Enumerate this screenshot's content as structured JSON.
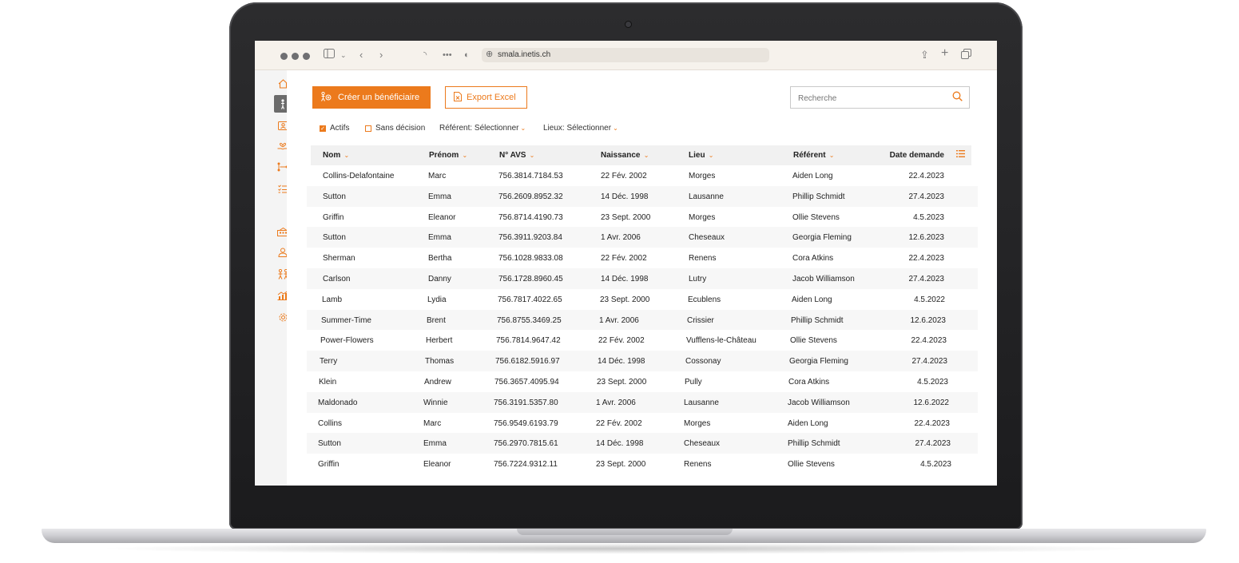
{
  "browser": {
    "url": "smala.inetis.ch"
  },
  "sidebar": {
    "items": [
      {
        "icon": "home-icon"
      },
      {
        "icon": "person-icon",
        "active": true
      },
      {
        "icon": "contact-card-icon"
      },
      {
        "icon": "hand-care-icon"
      },
      {
        "icon": "hierarchy-icon"
      },
      {
        "icon": "checklist-icon"
      },
      {
        "icon": "building-icon"
      },
      {
        "icon": "user-icon"
      },
      {
        "icon": "family-icon"
      },
      {
        "icon": "chart-icon"
      },
      {
        "icon": "gear-icon"
      }
    ]
  },
  "actions": {
    "create_label": "Créer un bénéficiaire",
    "export_label": "Export Excel",
    "search_placeholder": "Recherche"
  },
  "filters": {
    "actifs": {
      "label": "Actifs",
      "checked": true
    },
    "sans_decision": {
      "label": "Sans décision",
      "checked": false
    },
    "referent": "Référent: Sélectionner",
    "lieux": "Lieux: Sélectionner"
  },
  "table": {
    "headers": [
      "Nom",
      "Prénom",
      "N° AVS",
      "Naissance",
      "Lieu",
      "Référent",
      "Date demande"
    ],
    "rows": [
      [
        "Collins-Delafontaine",
        "Marc",
        "756.3814.7184.53",
        "22 Fév. 2002",
        "Morges",
        "Aiden Long",
        "22.4.2023"
      ],
      [
        "Sutton",
        "Emma",
        "756.2609.8952.32",
        "14 Déc. 1998",
        "Lausanne",
        "Phillip Schmidt",
        "27.4.2023"
      ],
      [
        "Griffin",
        "Eleanor",
        "756.8714.4190.73",
        "23 Sept. 2000",
        "Morges",
        "Ollie Stevens",
        "4.5.2023"
      ],
      [
        "Sutton",
        "Emma",
        "756.3911.9203.84",
        "1 Avr. 2006",
        "Cheseaux",
        "Georgia Fleming",
        "12.6.2023"
      ],
      [
        "Sherman",
        "Bertha",
        "756.1028.9833.08",
        "22 Fév. 2002",
        "Renens",
        "Cora Atkins",
        "22.4.2023"
      ],
      [
        "Carlson",
        "Danny",
        "756.1728.8960.45",
        "14 Déc. 1998",
        "Lutry",
        "Jacob Williamson",
        "27.4.2023"
      ],
      [
        "Lamb",
        "Lydia",
        "756.7817.4022.65",
        "23 Sept. 2000",
        "Ecublens",
        "Aiden Long",
        "4.5.2022"
      ],
      [
        "Summer-Time",
        "Brent",
        "756.8755.3469.25",
        "1 Avr. 2006",
        "Crissier",
        "Phillip Schmidt",
        "12.6.2023"
      ],
      [
        "Power-Flowers",
        "Herbert",
        "756.7814.9647.42",
        "22 Fév. 2002",
        "Vufflens-le-Château",
        "Ollie Stevens",
        "22.4.2023"
      ],
      [
        "Terry",
        "Thomas",
        "756.6182.5916.97",
        "14 Déc. 1998",
        "Cossonay",
        "Georgia Fleming",
        "27.4.2023"
      ],
      [
        "Klein",
        "Andrew",
        "756.3657.4095.94",
        "23 Sept. 2000",
        "Pully",
        "Cora Atkins",
        "4.5.2023"
      ],
      [
        "Maldonado",
        "Winnie",
        "756.3191.5357.80",
        "1 Avr. 2006",
        "Lausanne",
        "Jacob Williamson",
        "12.6.2022"
      ],
      [
        "Collins",
        "Marc",
        "756.9549.6193.79",
        "22 Fév. 2002",
        "Morges",
        "Aiden Long",
        "22.4.2023"
      ],
      [
        "Sutton",
        "Emma",
        "756.2970.7815.61",
        "14 Déc. 1998",
        "Cheseaux",
        "Phillip Schmidt",
        "27.4.2023"
      ],
      [
        "Griffin",
        "Eleanor",
        "756.7224.9312.11",
        "23 Sept. 2000",
        "Renens",
        "Ollie Stevens",
        "4.5.2023"
      ]
    ]
  },
  "colors": {
    "accent": "#ec7a1c",
    "laptop_bezel": "#1f1f21",
    "toolbar_bg": "#f6f2ec"
  }
}
